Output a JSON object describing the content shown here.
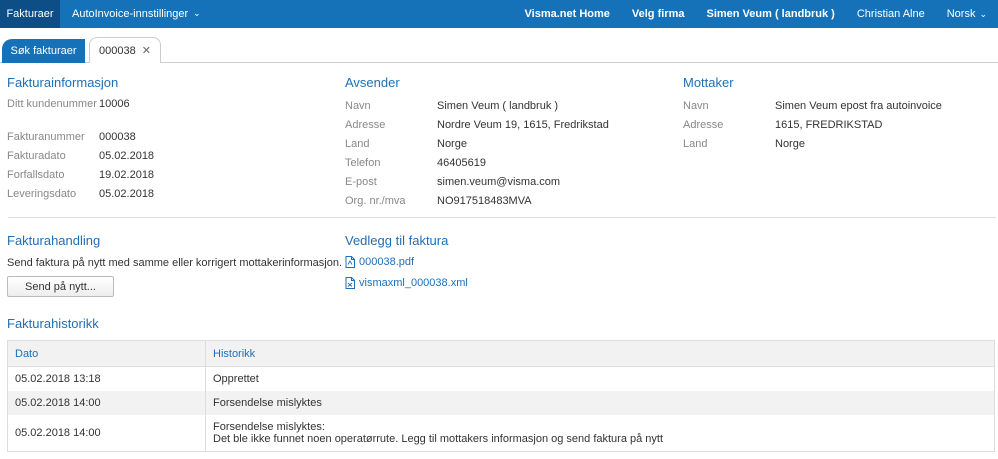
{
  "topnav": {
    "brand": "Fakturaer",
    "menu": "AutoInvoice-innstillinger",
    "right": [
      "Visma.net Home",
      "Velg firma",
      "Simen Veum ( landbruk )",
      "Christian Alne",
      "Norsk"
    ]
  },
  "tabs": {
    "search": "Søk fakturaer",
    "invoice": "000038"
  },
  "fakturainfo": {
    "title": "Fakturainformasjon",
    "rows": [
      {
        "k": "Ditt kundenummer",
        "v": "10006"
      },
      {
        "k": "Fakturanummer",
        "v": "000038"
      },
      {
        "k": "Fakturadato",
        "v": "05.02.2018"
      },
      {
        "k": "Forfallsdato",
        "v": "19.02.2018"
      },
      {
        "k": "Leveringsdato",
        "v": "05.02.2018"
      }
    ]
  },
  "avsender": {
    "title": "Avsender",
    "rows": [
      {
        "k": "Navn",
        "v": "Simen Veum ( landbruk )"
      },
      {
        "k": "Adresse",
        "v": "Nordre Veum 19, 1615, Fredrikstad"
      },
      {
        "k": "Land",
        "v": "Norge"
      },
      {
        "k": "Telefon",
        "v": "46405619"
      },
      {
        "k": "E-post",
        "v": "simen.veum@visma.com"
      },
      {
        "k": "Org. nr./mva",
        "v": "NO917518483MVA"
      }
    ]
  },
  "mottaker": {
    "title": "Mottaker",
    "rows": [
      {
        "k": "Navn",
        "v": "Simen Veum epost fra autoinvoice"
      },
      {
        "k": "Adresse",
        "v": "1615, FREDRIKSTAD"
      },
      {
        "k": "Land",
        "v": "Norge"
      }
    ]
  },
  "handling": {
    "title": "Fakturahandling",
    "text": "Send faktura på nytt med samme eller korrigert mottakerinformasjon.",
    "button": "Send på nytt..."
  },
  "vedlegg": {
    "title": "Vedlegg til faktura",
    "files": [
      "000038.pdf",
      "vismaxml_000038.xml"
    ]
  },
  "historikk": {
    "title": "Fakturahistorikk",
    "columns": [
      "Dato",
      "Historikk"
    ],
    "rows": [
      {
        "dato": "05.02.2018 13:18",
        "line1": "Opprettet",
        "line2": ""
      },
      {
        "dato": "05.02.2018 14:00",
        "line1": "Forsendelse mislyktes",
        "line2": ""
      },
      {
        "dato": "05.02.2018 14:00",
        "line1": "Forsendelse mislyktes:",
        "line2": "Det ble ikke funnet noen operatørrute. Legg til mottakers informasjon og send faktura på nytt"
      }
    ]
  },
  "colors": {
    "primary": "#1572b8",
    "brand_dark": "#0e4e86",
    "link": "#1f6fb5"
  }
}
